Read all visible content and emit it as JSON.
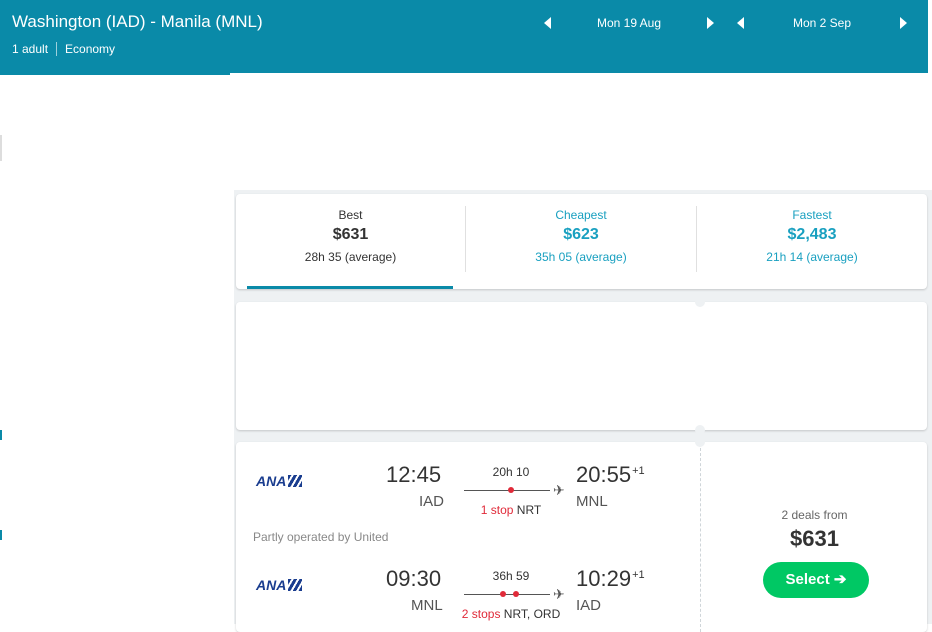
{
  "header": {
    "route": "Washington (IAD) - Manila (MNL)",
    "passengers": "1 adult",
    "cabin": "Economy",
    "depart_date": "Mon 19 Aug",
    "return_date": "Mon 2 Sep"
  },
  "sort_tabs": [
    {
      "label": "Best",
      "price": "$631",
      "duration": "28h 35 (average)"
    },
    {
      "label": "Cheapest",
      "price": "$623",
      "duration": "35h 05 (average)"
    },
    {
      "label": "Fastest",
      "price": "$2,483",
      "duration": "21h 14 (average)"
    }
  ],
  "result": {
    "outbound": {
      "airline": "ANA",
      "depart_time": "12:45",
      "depart_code": "IAD",
      "duration": "20h 10",
      "stops_label": "1 stop",
      "via": "NRT",
      "arrive_time": "20:55",
      "day_offset": "+1",
      "arrive_code": "MNL"
    },
    "operated_by": "Partly operated by United",
    "inbound": {
      "airline": "ANA",
      "depart_time": "09:30",
      "depart_code": "MNL",
      "duration": "36h 59",
      "stops_label": "2 stops",
      "via": "NRT, ORD",
      "arrive_time": "10:29",
      "day_offset": "+1",
      "arrive_code": "IAD"
    },
    "deals_label": "2 deals from",
    "deals_price": "$631",
    "select_label": "Select ➔"
  },
  "colors": {
    "header_bg": "#0a8aa8",
    "accent": "#19a0c0",
    "select_green": "#00c864",
    "stop_red": "#e02a39"
  }
}
